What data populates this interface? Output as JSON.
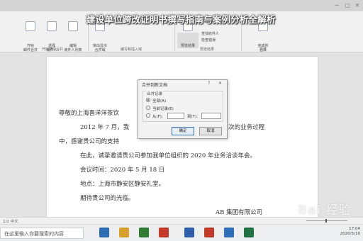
{
  "overlay_title": "建设单位跨改证明书撰写指南与案例分析全解析",
  "ribbon": {
    "buttons": [
      {
        "label": "开始\n邮件合并"
      },
      {
        "label": "选择\n收件人"
      },
      {
        "label": "编辑\n收件人列表"
      },
      {
        "label": "突出显示\n合并域"
      },
      {
        "label": "预览结果"
      },
      {
        "label": "完成并\n合并"
      }
    ],
    "groups": {
      "start_merge": "开始邮件合并",
      "write_insert": "编写和插入域",
      "preview": "预览结果",
      "finish": "完成"
    },
    "menu_items": [
      "查找收件人",
      "检查错误"
    ]
  },
  "document": {
    "salutation": "尊敬的上海喜洋洋茶饮",
    "line2_left": "2012 年 7 月，我",
    "line2_right": "0 次的业务过程",
    "line3": "中，感谢贵公司的支持",
    "line4": "在此，诚挚邀请贵公司参加我单位组织的 2020 年业务洽谈年会。",
    "line5": "会议时间：2020 年 5 月 18 日",
    "line6": "地点：上海市静安区静安礼堂。",
    "line7": "期待贵公司的光临。",
    "signature": "AB 集团有限公司"
  },
  "dialog": {
    "title": "合并到新文档",
    "help": "?",
    "close": "✕",
    "group_label": "合并记录",
    "options": [
      {
        "label": "全部(A)",
        "selected": true
      },
      {
        "label": "当前记录(E)",
        "selected": false
      },
      {
        "label": "从(F):",
        "selected": false
      }
    ],
    "to_label": "到(T):",
    "ok_label": "确定",
    "cancel_label": "取消"
  },
  "status": {
    "page_info": "1/2 中文"
  },
  "taskbar": {
    "search_placeholder": "在这里输入你要搜索的内容",
    "time": "17:04",
    "date": "2020/5/10",
    "app_colors": [
      "#2b6cb0",
      "#d5a02a",
      "#2e7d32",
      "#c0392b",
      "#2f5ea8",
      "#c0392b",
      "#2f6fb8",
      "#217346"
    ]
  },
  "watermark": "Bai 经验"
}
